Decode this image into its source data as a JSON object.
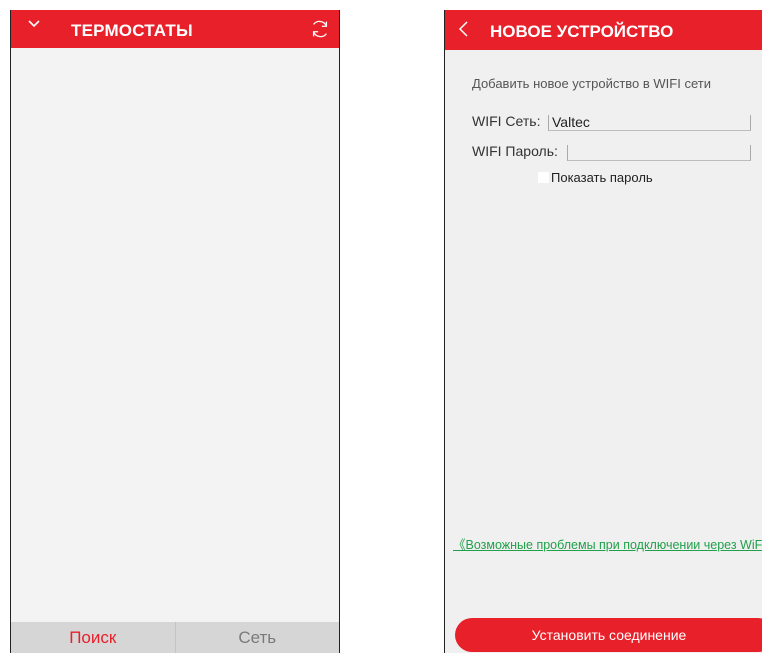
{
  "left_screen": {
    "title": "ТЕРМОСТАТЫ",
    "header_icons": [
      "chevron-down-icon",
      "refresh-icon"
    ],
    "tabs": [
      {
        "label": "Поиск",
        "active": true
      },
      {
        "label": "Сеть",
        "active": false
      }
    ]
  },
  "right_screen": {
    "title": "НОВОЕ УСТРОЙСТВО",
    "subtitle": "Добавить новое устройство в WIFI сети",
    "wifi_network_label": "WIFI Сеть:",
    "wifi_network_value": "Valtec",
    "wifi_password_label": "WIFI Пароль:",
    "wifi_password_value": "",
    "show_password_label": "Показать пароль",
    "show_password_checked": false,
    "problems_link": "《Возможные проблемы при подключении через WiFi》",
    "connect_button": "Установить соединение"
  },
  "colors": {
    "accent": "#e8202a",
    "link": "#21a04a",
    "tab_bar": "#d6d6d6"
  }
}
